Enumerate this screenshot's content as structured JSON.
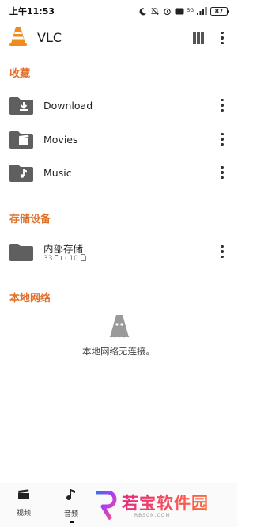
{
  "status_bar": {
    "time": "上午11:53",
    "battery": "87",
    "network_label": "5G"
  },
  "app_bar": {
    "title": "VLC",
    "icons": [
      "vlc-cone-icon",
      "grid-view-icon",
      "more-vert-icon"
    ]
  },
  "favorites": {
    "title": "收藏",
    "items": [
      {
        "label": "Download",
        "icon": "download-folder-icon"
      },
      {
        "label": "Movies",
        "icon": "movie-folder-icon"
      },
      {
        "label": "Music",
        "icon": "music-folder-icon"
      }
    ]
  },
  "storage": {
    "title": "存储设备",
    "items": [
      {
        "label": "内部存储",
        "folders": "33",
        "files": "10"
      }
    ]
  },
  "local_network": {
    "title": "本地网络",
    "empty_text": "本地网络无连接。"
  },
  "bottom_nav": {
    "items": [
      {
        "label": "视频",
        "icon": "video-clapper-icon"
      },
      {
        "label": "音频",
        "icon": "music-note-icon"
      }
    ]
  },
  "watermark": {
    "text": "若宝软件园",
    "url": "RBSCN.COM"
  },
  "colors": {
    "accent": "#e1712a",
    "folder": "#5f5f5f",
    "background": "#ffffff"
  }
}
